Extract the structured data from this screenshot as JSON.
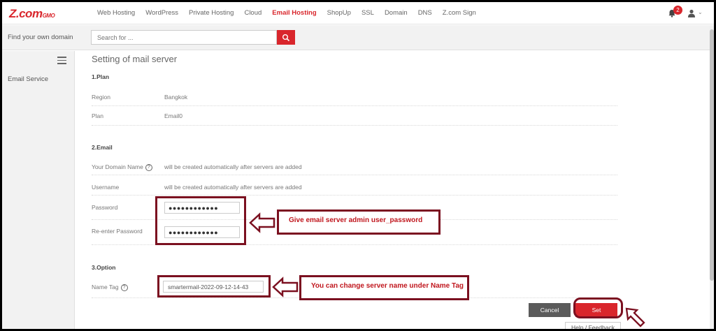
{
  "brand": {
    "logo_main": "Z.com",
    "logo_suffix": "by GMO"
  },
  "nav": {
    "items": [
      {
        "label": "Web Hosting",
        "active": false
      },
      {
        "label": "WordPress",
        "active": false
      },
      {
        "label": "Private Hosting",
        "active": false
      },
      {
        "label": "Cloud",
        "active": false
      },
      {
        "label": "Email Hosting",
        "active": true
      },
      {
        "label": "ShopUp",
        "active": false
      },
      {
        "label": "SSL",
        "active": false
      },
      {
        "label": "Domain",
        "active": false
      },
      {
        "label": "DNS",
        "active": false
      },
      {
        "label": "Z.com Sign",
        "active": false
      }
    ],
    "notification_count": "2"
  },
  "search": {
    "label": "Find your own domain",
    "placeholder": "Search for ..."
  },
  "sidebar": {
    "items": [
      {
        "label": "Email Service"
      }
    ]
  },
  "main": {
    "title": "Setting of mail server",
    "plan": {
      "section_label": "1.Plan",
      "region_label": "Region",
      "region_value": "Bangkok",
      "plan_label": "Plan",
      "plan_value": "Email0"
    },
    "email": {
      "section_label": "2.Email",
      "domain_label": "Your Domain Name",
      "domain_value": "will be created automatically after servers are added",
      "username_label": "Username",
      "username_value": "will be created automatically after servers are added",
      "password_label": "Password",
      "password_value": "●●●●●●●●●●●●",
      "reenter_label": "Re-enter Password",
      "reenter_value": "●●●●●●●●●●●●"
    },
    "option": {
      "section_label": "3.Option",
      "nametag_label": "Name Tag",
      "nametag_value": "smartermail-2022-09-12-14-43"
    },
    "buttons": {
      "cancel": "Cancel",
      "set": "Set"
    },
    "help_feedback": "Help / Feedback",
    "help_icon_glyph": "?"
  },
  "annotations": {
    "password_note": "Give email server admin user_password",
    "nametag_note": "You can change server name under Name Tag"
  },
  "colors": {
    "brand_red": "#d9262c",
    "annotation_border": "#7b1020",
    "annotation_text": "#c0161d"
  }
}
